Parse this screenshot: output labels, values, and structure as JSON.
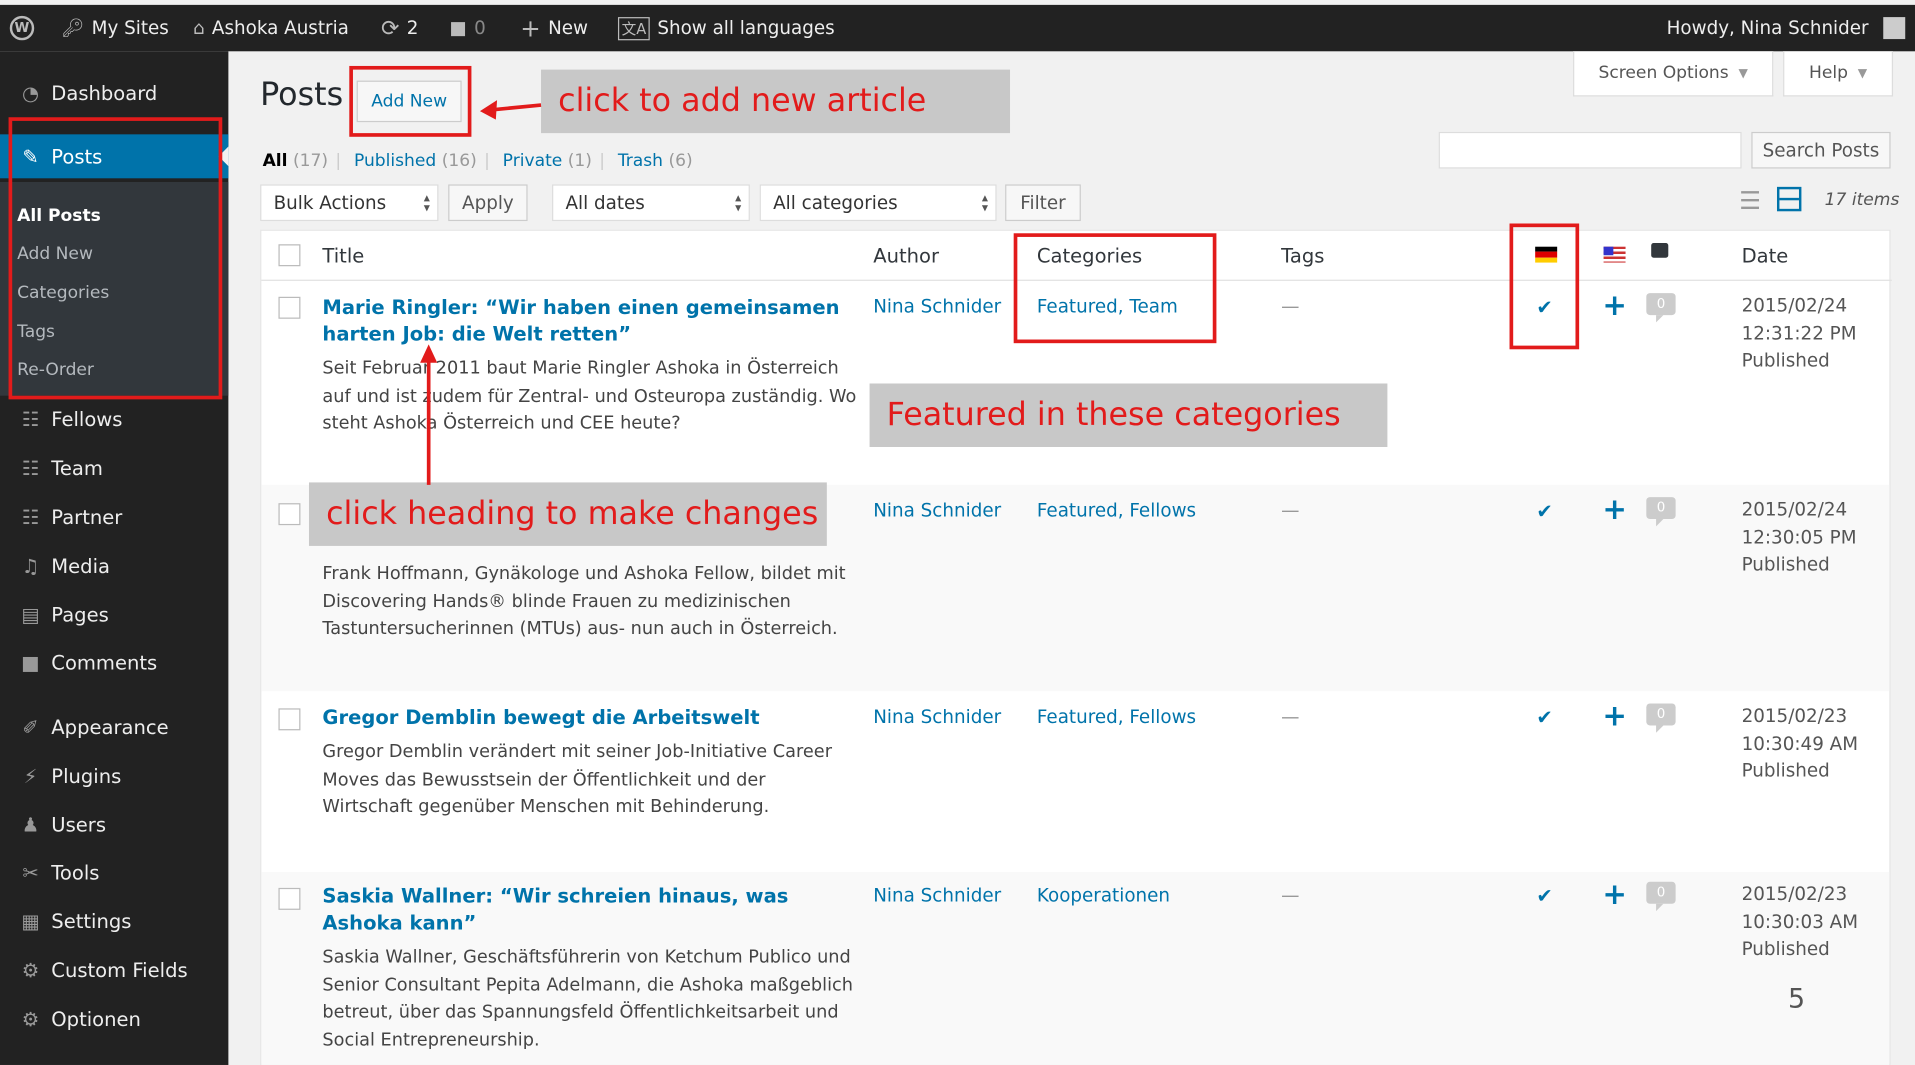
{
  "adminbar": {
    "wp_logo": "wordpress-logo-icon",
    "my_sites": "My Sites",
    "site_name": "Ashoka Austria",
    "updates_count": "2",
    "comments_count": "0",
    "new_label": "New",
    "languages_label": "Show all languages",
    "howdy": "Howdy, Nina Schnider"
  },
  "sidebar": {
    "items": [
      {
        "label": "Dashboard",
        "icon": "dashboard-icon"
      },
      {
        "label": "Posts",
        "icon": "pin-icon"
      },
      {
        "label": "Fellows",
        "icon": "people-icon"
      },
      {
        "label": "Team",
        "icon": "people-icon"
      },
      {
        "label": "Partner",
        "icon": "people-icon"
      },
      {
        "label": "Media",
        "icon": "media-icon"
      },
      {
        "label": "Pages",
        "icon": "pages-icon"
      },
      {
        "label": "Comments",
        "icon": "comments-icon"
      },
      {
        "label": "Appearance",
        "icon": "appearance-icon"
      },
      {
        "label": "Plugins",
        "icon": "plugins-icon"
      },
      {
        "label": "Users",
        "icon": "users-icon"
      },
      {
        "label": "Tools",
        "icon": "tools-icon"
      },
      {
        "label": "Settings",
        "icon": "settings-icon"
      },
      {
        "label": "Custom Fields",
        "icon": "gear-icon"
      },
      {
        "label": "Optionen",
        "icon": "gear-icon"
      }
    ],
    "submenu": [
      "All Posts",
      "Add New",
      "Categories",
      "Tags",
      "Re-Order"
    ]
  },
  "header": {
    "title": "Posts",
    "add_new": "Add New",
    "screen_options": "Screen Options",
    "help": "Help"
  },
  "filters": {
    "all": "All",
    "all_count": "(17)",
    "published": "Published",
    "published_count": "(16)",
    "private": "Private",
    "private_count": "(1)",
    "trash": "Trash",
    "trash_count": "(6)"
  },
  "search": {
    "button": "Search Posts"
  },
  "toolbar": {
    "bulk_actions": "Bulk Actions",
    "apply": "Apply",
    "all_dates": "All dates",
    "all_categories": "All categories",
    "filter": "Filter",
    "items_count": "17 items"
  },
  "table": {
    "headers": {
      "title": "Title",
      "author": "Author",
      "categories": "Categories",
      "tags": "Tags",
      "date": "Date"
    },
    "rows": [
      {
        "title": "Marie Ringler: “Wir haben einen gemeinsamen harten Job: die Welt retten”",
        "excerpt": "Seit Februar 2011 baut Marie Ringler Ashoka in Österreich auf und ist zudem für Zentral- und Osteuropa zuständig. Wo steht Ashoka Österreich und CEE heute?",
        "author": "Nina Schnider",
        "categories": "Featured, Team",
        "tags": "—",
        "comments": "0",
        "date": "2015/02/24",
        "time": "12:31:22 PM",
        "status": "Published"
      },
      {
        "title": "",
        "excerpt": "Frank Hoffmann, Gynäkologe und Ashoka Fellow, bildet mit Discovering Hands® blinde Frauen zu medizinischen Tastuntersucherinnen (MTUs) aus- nun auch in Österreich.",
        "author": "Nina Schnider",
        "categories": "Featured, Fellows",
        "tags": "—",
        "comments": "0",
        "date": "2015/02/24",
        "time": "12:30:05 PM",
        "status": "Published"
      },
      {
        "title": "Gregor Demblin bewegt die Arbeitswelt",
        "excerpt": "Gregor Demblin verändert mit seiner Job-Initiative Career Moves das Bewusstsein der Öffentlichkeit und der Wirtschaft gegenüber Menschen mit Behinderung.",
        "author": "Nina Schnider",
        "categories": "Featured, Fellows",
        "tags": "—",
        "comments": "0",
        "date": "2015/02/23",
        "time": "10:30:49 AM",
        "status": "Published"
      },
      {
        "title": "Saskia Wallner: “Wir schreien hinaus, was Ashoka kann”",
        "excerpt": "Saskia Wallner, Geschäftsführerin von Ketchum Publico und Senior Consultant Pepita Adelmann, die Ashoka maßgeblich betreut, über das Spannungsfeld Öffentlichkeitsarbeit und Social Entrepreneurship.",
        "author": "Nina Schnider",
        "categories": "Kooperationen",
        "tags": "—",
        "comments": "0",
        "date": "2015/02/23",
        "time": "10:30:03 AM",
        "status": "Published"
      }
    ]
  },
  "annotations": {
    "add_new": "click to add new article",
    "categories": "Featured in these categories",
    "heading": "click heading to make changes"
  },
  "page_number": "5",
  "colors": {
    "accent": "#0073aa",
    "annotation": "#e21b1b",
    "adminbar": "#222222"
  }
}
